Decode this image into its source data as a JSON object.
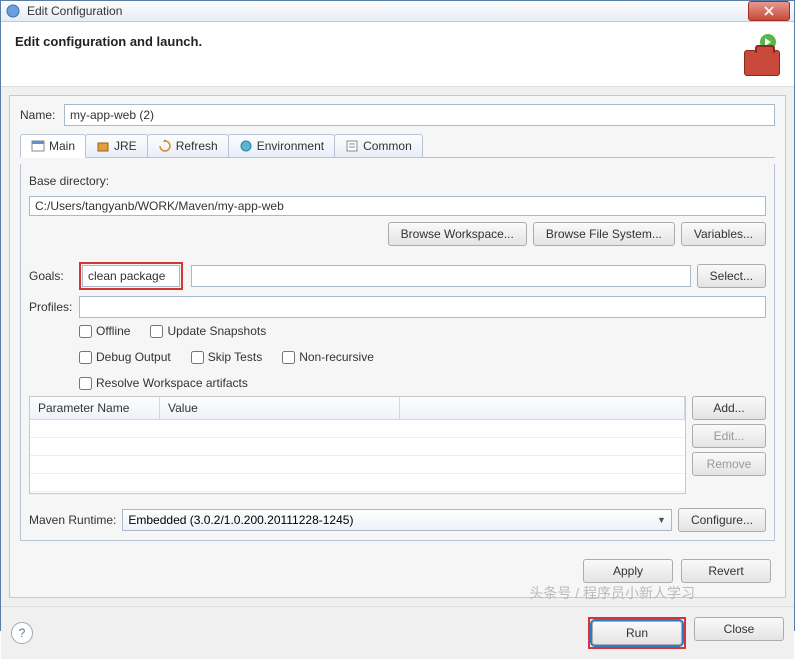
{
  "window": {
    "title": "Edit Configuration"
  },
  "header": {
    "title": "Edit configuration and launch."
  },
  "name": {
    "label": "Name:",
    "value": "my-app-web (2)"
  },
  "tabs": [
    {
      "label": "Main"
    },
    {
      "label": "JRE"
    },
    {
      "label": "Refresh"
    },
    {
      "label": "Environment"
    },
    {
      "label": "Common"
    }
  ],
  "baseDir": {
    "label": "Base directory:",
    "value": "C:/Users/tangyanb/WORK/Maven/my-app-web",
    "browseWorkspace": "Browse Workspace...",
    "browseFileSystem": "Browse File System...",
    "variables": "Variables..."
  },
  "goals": {
    "label": "Goals:",
    "value": "clean package",
    "select": "Select..."
  },
  "profiles": {
    "label": "Profiles:",
    "value": ""
  },
  "checks": {
    "offline": "Offline",
    "updateSnapshots": "Update Snapshots",
    "debugOutput": "Debug Output",
    "skipTests": "Skip Tests",
    "nonRecursive": "Non-recursive",
    "resolveWorkspace": "Resolve Workspace artifacts"
  },
  "table": {
    "cols": {
      "param": "Parameter Name",
      "value": "Value"
    },
    "add": "Add...",
    "edit": "Edit...",
    "remove": "Remove"
  },
  "runtime": {
    "label": "Maven Runtime:",
    "value": "Embedded (3.0.2/1.0.200.20111228-1245)",
    "configure": "Configure..."
  },
  "actions": {
    "apply": "Apply",
    "revert": "Revert"
  },
  "footer": {
    "run": "Run",
    "close": "Close"
  },
  "watermark": "头条号 / 程序员小新人学习"
}
